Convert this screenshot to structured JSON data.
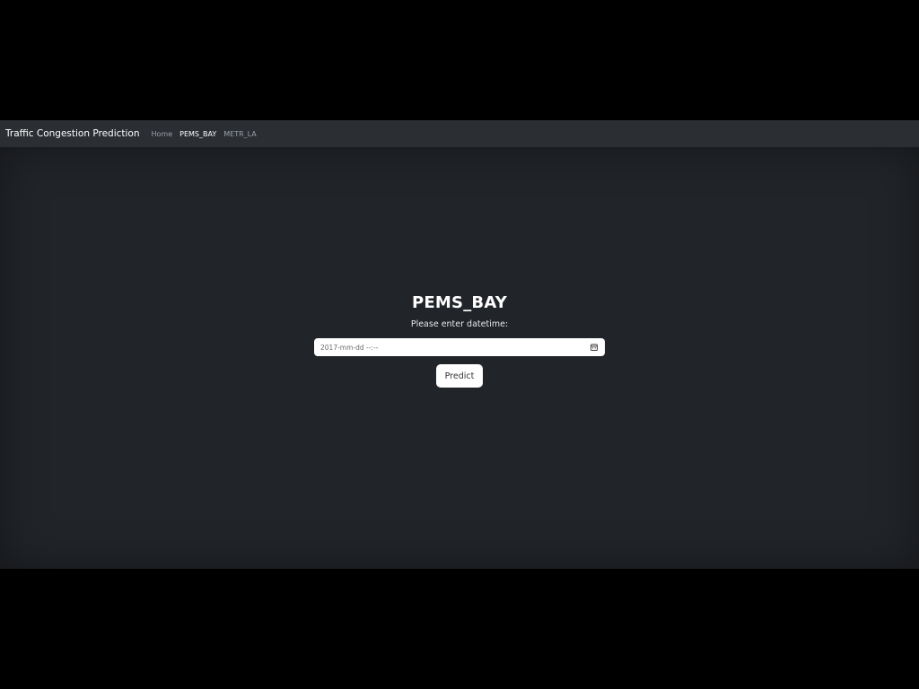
{
  "navbar": {
    "brand": "Traffic Congestion Prediction",
    "links": [
      {
        "label": "Home",
        "active": false
      },
      {
        "label": "PEMS_BAY",
        "active": true
      },
      {
        "label": "METR_LA",
        "active": false
      }
    ]
  },
  "main": {
    "title": "PEMS_BAY",
    "prompt": "Please enter datetime:",
    "datetime_input": {
      "placeholder": "2017-mm-dd --:--",
      "value": ""
    },
    "calendar_icon": "calendar-icon",
    "predict_label": "Predict"
  },
  "colors": {
    "page_background": "#212429",
    "navbar_background": "#2b2e33",
    "letterbox": "#000000",
    "active_link": "#ffffff",
    "inactive_link": "#9aa0a7",
    "button_background": "#ffffff"
  }
}
